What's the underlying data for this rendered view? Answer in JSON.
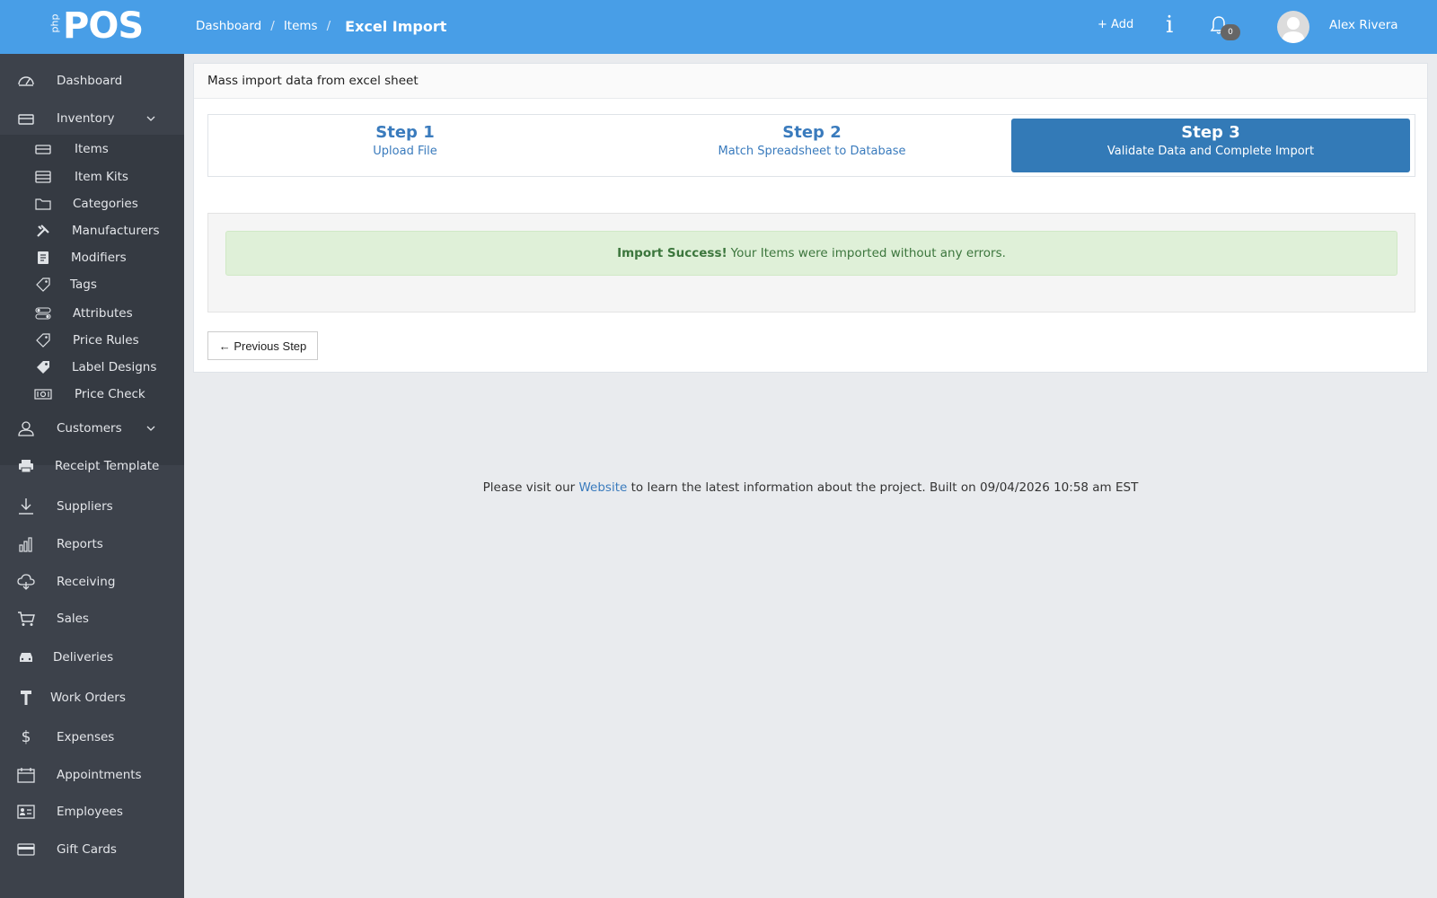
{
  "header": {
    "logo_prefix": "php",
    "logo_main": "POS",
    "breadcrumbs": [
      "Dashboard",
      "Items"
    ],
    "current_page": "Excel Import",
    "add_label": "+ Add",
    "info_label": "i",
    "notification_count": "0",
    "user_name": "Alex Rivera"
  },
  "sidebar": {
    "items": [
      {
        "label": "Dashboard",
        "icon": "dashboard-icon"
      },
      {
        "label": "Inventory",
        "icon": "inventory-icon",
        "expanded": true
      },
      {
        "label": "Customers",
        "icon": "customers-icon"
      },
      {
        "label": "Receipt Template",
        "icon": "printer-icon"
      },
      {
        "label": "Suppliers",
        "icon": "download-icon"
      },
      {
        "label": "Reports",
        "icon": "bar-chart-icon"
      },
      {
        "label": "Receiving",
        "icon": "cloud-icon"
      },
      {
        "label": "Sales",
        "icon": "cart-icon"
      },
      {
        "label": "Deliveries",
        "icon": "car-icon"
      },
      {
        "label": "Work Orders",
        "icon": "hammer-icon"
      },
      {
        "label": "Expenses",
        "icon": "dollar-icon"
      },
      {
        "label": "Appointments",
        "icon": "calendar-icon"
      },
      {
        "label": "Employees",
        "icon": "id-card-icon"
      },
      {
        "label": "Gift Cards",
        "icon": "credit-card-icon"
      }
    ],
    "inventory_sub": [
      {
        "label": "Items",
        "icon": "box-icon"
      },
      {
        "label": "Item Kits",
        "icon": "kit-icon"
      },
      {
        "label": "Categories",
        "icon": "folder-icon"
      },
      {
        "label": "Manufacturers",
        "icon": "tools-icon"
      },
      {
        "label": "Modifiers",
        "icon": "list-icon"
      },
      {
        "label": "Tags",
        "icon": "tag-icon"
      },
      {
        "label": "Attributes",
        "icon": "toggles-icon"
      },
      {
        "label": "Price Rules",
        "icon": "tag-outline-icon"
      },
      {
        "label": "Label Designs",
        "icon": "tag-solid-icon"
      },
      {
        "label": "Price Check",
        "icon": "money-icon"
      }
    ]
  },
  "main": {
    "panel_title": "Mass import data from excel sheet",
    "steps": [
      {
        "title": "Step 1",
        "desc": "Upload File",
        "active": false
      },
      {
        "title": "Step 2",
        "desc": "Match Spreadsheet to Database",
        "active": false
      },
      {
        "title": "Step 3",
        "desc": "Validate Data and Complete Import",
        "active": true
      }
    ],
    "alert_strong": "Import Success!",
    "alert_text": "Your Items were imported without any errors.",
    "prev_button": "← Previous Step"
  },
  "footer": {
    "text_before": "Please visit our",
    "link_text": "Website",
    "text_after": "to learn the latest information about the project. Built on 09/04/2026 10:58 am EST"
  },
  "colors": {
    "topbar": "#489ee7",
    "sidebar": "#3d424b",
    "active_step": "#337ab7",
    "success_bg": "#dff0d8",
    "success_text": "#3c763d"
  }
}
